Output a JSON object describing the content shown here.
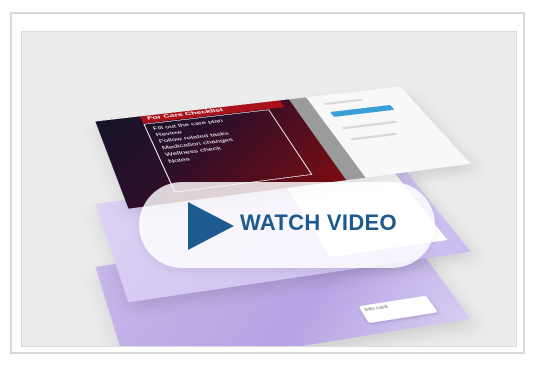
{
  "video": {
    "label": "WATCH VIDEO",
    "accent": "#1f5a8e"
  },
  "preview": {
    "banner": "For Care Checklist",
    "items": [
      "Fill out the care plan",
      "Review",
      "Follow related tasks",
      "Medication changes",
      "Wellness check",
      "Notes"
    ],
    "card": "Info card"
  }
}
